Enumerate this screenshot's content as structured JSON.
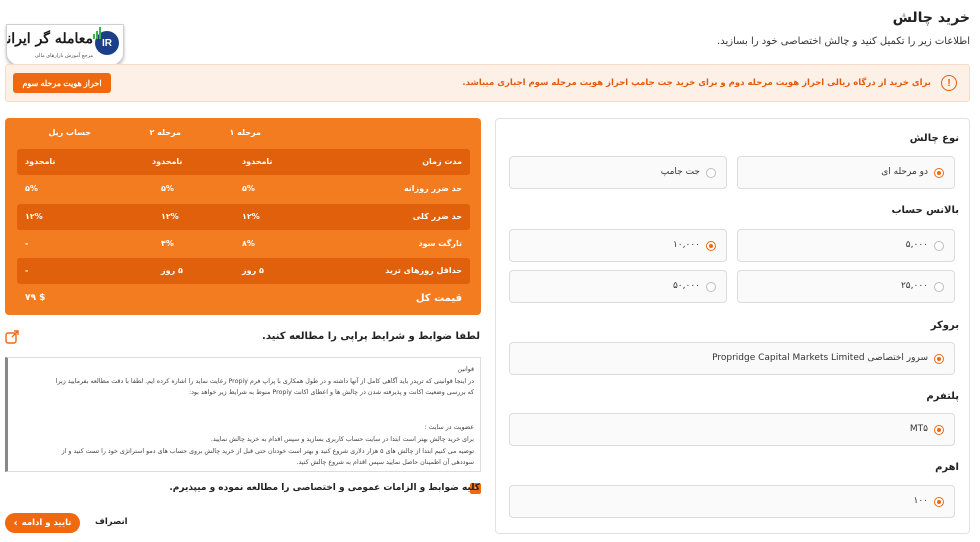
{
  "logo": {
    "name": "معامله گر ایرانی",
    "tagline": "مرجع آموزش بازارهای مالی",
    "badge": "IR"
  },
  "page": {
    "title": "خرید چالش",
    "subtitle": "اطلاعات زیر را تکمیل کنید و چالش اختصاصی خود را بسازید."
  },
  "alert": {
    "message": "برای خرید از درگاه ریالی احراز هویت مرحله دوم و برای خرید جت جامپ احراز هویت مرحله سوم اجباری میباشد.",
    "button": "احراز هویت مرحله سوم",
    "icon": "!"
  },
  "form": {
    "challenge_type": {
      "label": "نوع چالش",
      "options": [
        "دو مرحله ای",
        "جت جامپ"
      ],
      "selected": 0
    },
    "balance": {
      "label": "بالانس حساب",
      "options": [
        "۵,۰۰۰",
        "۱۰,۰۰۰",
        "۲۵,۰۰۰",
        "۵۰,۰۰۰"
      ],
      "selected": 1
    },
    "broker": {
      "label": "بروکر",
      "option": "سرور اختصاصی Propridge Capital Markets Limited"
    },
    "platform": {
      "label": "پلتفرم",
      "option": "MT۵"
    },
    "leverage": {
      "label": "اهرم",
      "option": "۱۰۰"
    }
  },
  "table": {
    "headers": [
      "مرحله ۱",
      "مرحله ۲",
      "حساب ریل"
    ],
    "rows": [
      {
        "label": "مدت زمان",
        "values": [
          "نامحدود",
          "نامحدود",
          "نامحدود"
        ]
      },
      {
        "label": "حد ضرر روزانه",
        "values": [
          "۵%",
          "۵%",
          "۵%"
        ]
      },
      {
        "label": "حد ضرر کلی",
        "values": [
          "۱۲%",
          "۱۲%",
          "۱۲%"
        ]
      },
      {
        "label": "تارگت سود",
        "values": [
          "۸%",
          "۴%",
          "-"
        ]
      },
      {
        "label": "حداقل روزهای ترید",
        "values": [
          "۵ روز",
          "۵ روز",
          "-"
        ]
      }
    ],
    "total_label": "قیمت کل",
    "total_value": "$ ۷۹"
  },
  "terms": {
    "title": "لطفا ضوابط و شرایط پراپی را مطالعه کنید.",
    "lines": [
      "قوانین",
      "در اینجا قوانینی که تریدر باید آگاهی کامل از آنها داشته و در طول همکاری با پراپ فرم Propiy رعایت نماید را اشاره کرده ایم. لطفا با دقت مطالعه بفرمایید زیرا",
      "که بررسی وضعیت اکانت و پذیرفته شدن در چالش ها و اعطای اکانت Propiy منوط به شرایط زیر خواهد بود:",
      "",
      "عضویت در سایت :",
      "برای خرید چالش بهتر است ابتدا در سایت حساب کاربری بسازید و سپس اقدام به خرید چالش نمایید.",
      "توصیه می کنیم ابتدا از چالش های ۵ هزار دلاری شروع کنید و بهتر است خودتان حتی قبل از خرید چالش بروی حساب های دمو استراتژی خود را تست کنید و از",
      "سوددهی آن اطمینان حاصل نمایید سپس اقدام به شروع چالش کنید."
    ],
    "agree": "کلیه ضوابط و الزامات عمومی و اختصاصی را مطالعه نموده و میپذیرم."
  },
  "actions": {
    "confirm": "تایید و ادامه",
    "cancel": "انصراف"
  }
}
